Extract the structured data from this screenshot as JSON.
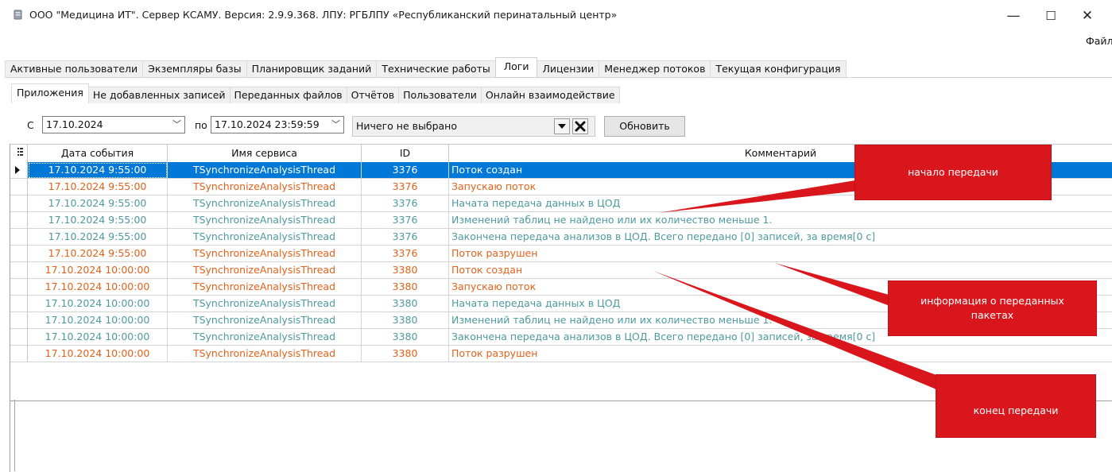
{
  "window": {
    "title": "ООО \"Медицина ИТ\". Сервер КСАМУ. Версия: 2.9.9.368. ЛПУ: РГБЛПУ «Республиканский перинатальный центр»",
    "minimize": "—",
    "maximize": "☐",
    "close": "✕",
    "icon": "app-db-icon"
  },
  "menu": {
    "file": "Файл"
  },
  "tabs_top": [
    {
      "label": "Активные пользователи",
      "active": false
    },
    {
      "label": "Экземпляры базы",
      "active": false
    },
    {
      "label": "Планировщик заданий",
      "active": false
    },
    {
      "label": "Технические работы",
      "active": false
    },
    {
      "label": "Логи",
      "active": true
    },
    {
      "label": "Лицензии",
      "active": false
    },
    {
      "label": "Менеджер потоков",
      "active": false
    },
    {
      "label": "Текущая конфигурация",
      "active": false
    }
  ],
  "tabs_sub": [
    {
      "label": "Приложения",
      "active": true
    },
    {
      "label": "Не добавленных записей",
      "active": false
    },
    {
      "label": "Переданных файлов",
      "active": false
    },
    {
      "label": "Отчётов",
      "active": false
    },
    {
      "label": "Пользователи",
      "active": false
    },
    {
      "label": "Онлайн взаимодействие",
      "active": false
    }
  ],
  "filter": {
    "from_label": "С",
    "from_value": "17.10.2024",
    "to_label": "по",
    "to_value": "17.10.2024 23:59:59",
    "selection_value": "Ничего не выбрано",
    "refresh_label": "Обновить",
    "dropdown_icon": "dropdown-arrow-icon",
    "clear_icon": "clear-x-icon"
  },
  "grid": {
    "columns": [
      "Дата события",
      "Имя сервиса",
      "ID",
      "Комментарий"
    ],
    "colors": {
      "orange": "#e2621b",
      "teal": "#4e9a9f",
      "selected_bg": "#0078d7"
    },
    "rows": [
      {
        "date": "17.10.2024 9:55:00",
        "service": "TSynchronizeAnalysisThread",
        "id": "3376",
        "comment": "Поток создан",
        "color": "orange",
        "selected": true
      },
      {
        "date": "17.10.2024 9:55:00",
        "service": "TSynchronizeAnalysisThread",
        "id": "3376",
        "comment": "Запускаю поток",
        "color": "orange",
        "selected": false
      },
      {
        "date": "17.10.2024 9:55:00",
        "service": "TSynchronizeAnalysisThread",
        "id": "3376",
        "comment": "Начата передача данных в ЦОД",
        "color": "teal",
        "selected": false
      },
      {
        "date": "17.10.2024 9:55:00",
        "service": "TSynchronizeAnalysisThread",
        "id": "3376",
        "comment": "Изменений таблиц не найдено или их количество меньше 1.",
        "color": "teal",
        "selected": false
      },
      {
        "date": "17.10.2024 9:55:00",
        "service": "TSynchronizeAnalysisThread",
        "id": "3376",
        "comment": "Закончена передача анализов в ЦОД. Всего передано [0] записей, за время[0 с]",
        "color": "teal",
        "selected": false
      },
      {
        "date": "17.10.2024 9:55:00",
        "service": "TSynchronizeAnalysisThread",
        "id": "3376",
        "comment": "Поток разрушен",
        "color": "orange",
        "selected": false
      },
      {
        "date": "17.10.2024 10:00:00",
        "service": "TSynchronizeAnalysisThread",
        "id": "3380",
        "comment": "Поток создан",
        "color": "orange",
        "selected": false
      },
      {
        "date": "17.10.2024 10:00:00",
        "service": "TSynchronizeAnalysisThread",
        "id": "3380",
        "comment": "Запускаю поток",
        "color": "orange",
        "selected": false
      },
      {
        "date": "17.10.2024 10:00:00",
        "service": "TSynchronizeAnalysisThread",
        "id": "3380",
        "comment": "Начата передача данных в ЦОД",
        "color": "teal",
        "selected": false
      },
      {
        "date": "17.10.2024 10:00:00",
        "service": "TSynchronizeAnalysisThread",
        "id": "3380",
        "comment": "Изменений таблиц не найдено или их количество меньше 1.",
        "color": "teal",
        "selected": false
      },
      {
        "date": "17.10.2024 10:00:00",
        "service": "TSynchronizeAnalysisThread",
        "id": "3380",
        "comment": "Закончена передача анализов в ЦОД. Всего передано [0] записей, за время[0 с]",
        "color": "teal",
        "selected": false
      },
      {
        "date": "17.10.2024 10:00:00",
        "service": "TSynchronizeAnalysisThread",
        "id": "3380",
        "comment": "Поток разрушен",
        "color": "orange",
        "selected": false
      }
    ]
  },
  "annotations": {
    "start": "начало передачи",
    "info": "информация о переданных пакетах",
    "end": "конец передачи",
    "color": "#d9161c"
  }
}
